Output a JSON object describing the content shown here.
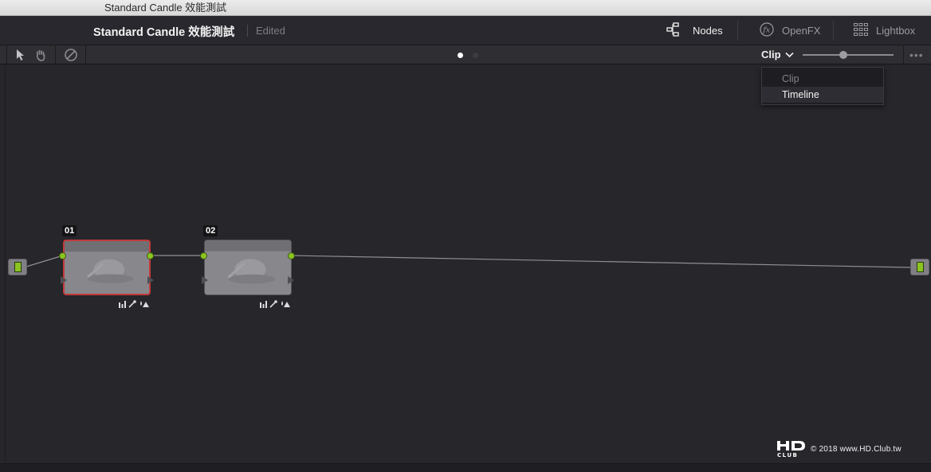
{
  "window": {
    "title": "Standard Candle 效能測試"
  },
  "header": {
    "project_title": "Standard Candle 效能測試",
    "status": "Edited",
    "buttons": [
      {
        "label": "Nodes",
        "icon": "nodes-icon",
        "active": true
      },
      {
        "label": "OpenFX",
        "icon": "fx-icon",
        "active": false
      },
      {
        "label": "Lightbox",
        "icon": "grid-icon",
        "active": false
      }
    ]
  },
  "toolbar": {
    "tools": [
      "pointer-icon",
      "hand-icon",
      "bypass-icon"
    ],
    "page_indicator": {
      "pages": 2,
      "current": 1
    },
    "mode_select": {
      "value": "Clip"
    },
    "zoom_level": 0.45,
    "more": "•••"
  },
  "mode_dropdown": {
    "options": [
      {
        "label": "Clip",
        "state": "disabled"
      },
      {
        "label": "Timeline",
        "state": "active"
      }
    ]
  },
  "node_graph": {
    "nodes": [
      {
        "label": "01",
        "selected": true,
        "tools": [
          "histogram-icon",
          "picker-icon",
          "qualifier-icon"
        ]
      },
      {
        "label": "02",
        "selected": false,
        "tools": [
          "histogram-icon",
          "picker-icon",
          "qualifier-icon"
        ]
      }
    ],
    "input_port": "source",
    "output_port": "output"
  },
  "watermark": {
    "logo_text": "HD CLUB",
    "text": "© 2018 www.HD.Club.tw"
  },
  "colors": {
    "accent_green": "#8ac41f",
    "selected_red": "#c23a3a",
    "background": "#26262b"
  }
}
